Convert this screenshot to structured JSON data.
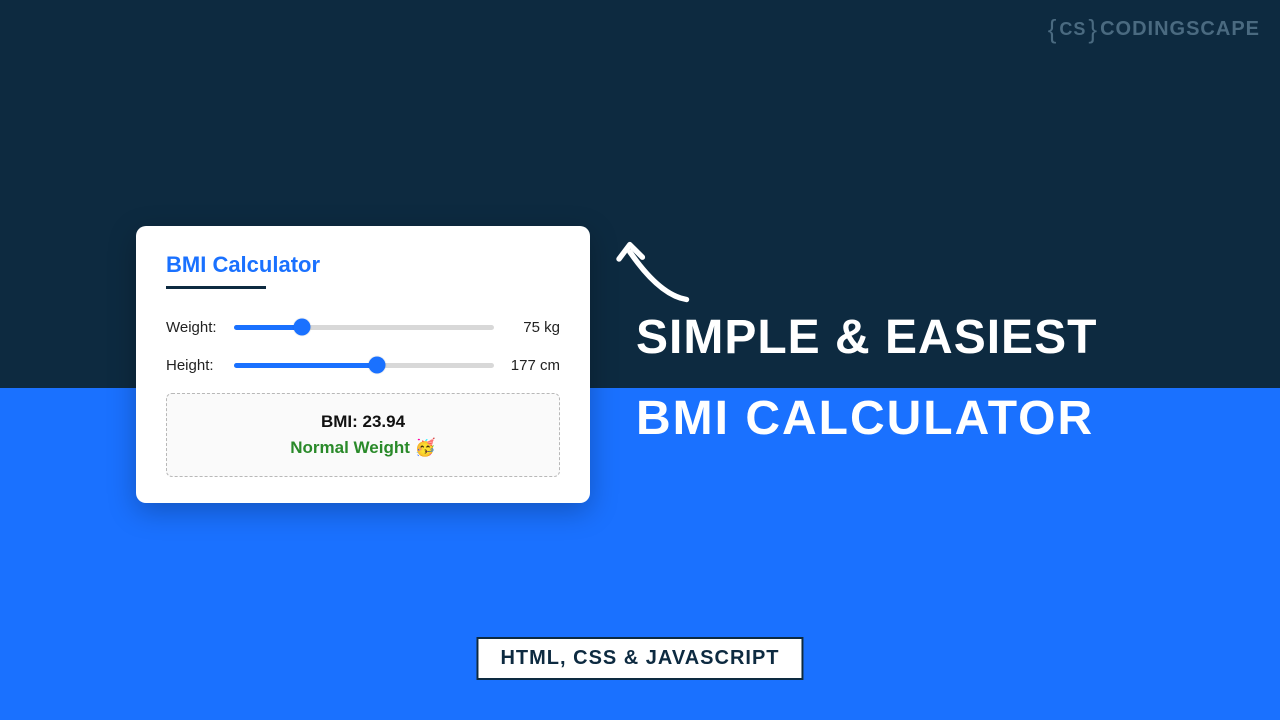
{
  "brand": {
    "brace_open": "{",
    "cs": "CS",
    "brace_close": "}",
    "name": "CODINGSCAPE"
  },
  "headline": {
    "line1": "SIMPLE & EASIEST",
    "line2": "BMI CALCULATOR"
  },
  "card": {
    "title": "BMI Calculator",
    "weight": {
      "label": "Weight:",
      "value": "75 kg",
      "fill_pct": 26
    },
    "height": {
      "label": "Height:",
      "value": "177 cm",
      "fill_pct": 55
    },
    "result": {
      "bmi_label": "BMI: 23.94",
      "status": "Normal Weight 🥳"
    }
  },
  "tech": "HTML, CSS & JAVASCRIPT"
}
